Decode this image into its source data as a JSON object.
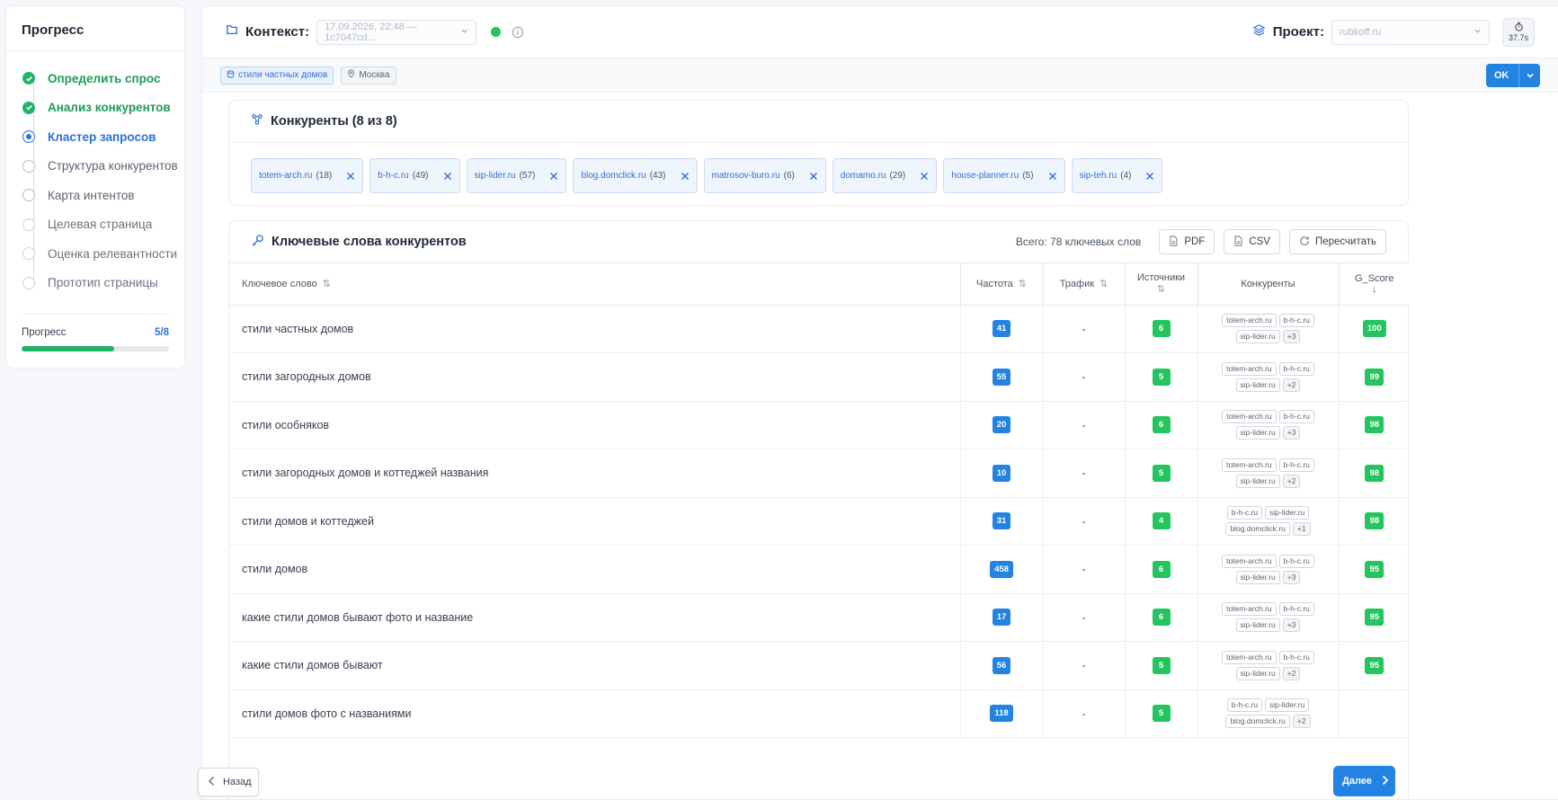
{
  "sidebar": {
    "title": "Прогресс",
    "steps": [
      {
        "label": "Определить спрос",
        "state": "done"
      },
      {
        "label": "Анализ конкурентов",
        "state": "done"
      },
      {
        "label": "Кластер запросов",
        "state": "active"
      },
      {
        "label": "Структура конкурентов",
        "state": "pending"
      },
      {
        "label": "Карта интентов",
        "state": "pending"
      },
      {
        "label": "Целевая страница",
        "state": "pending"
      },
      {
        "label": "Оценка релевантности",
        "state": "pending"
      },
      {
        "label": "Прототип страницы",
        "state": "pending"
      }
    ],
    "progress_label": "Прогресс",
    "progress_count": "5/8",
    "progress_value": 0.625
  },
  "topbar": {
    "context_label": "Контекст:",
    "context_value": "17.09.2026, 22:48 — 1c7047cd…",
    "project_label": "Проект:",
    "project_value": "rubkoff.ru",
    "timer": "37.7s"
  },
  "subbar": {
    "query_chip": "стили частных домов",
    "region_chip": "Москва",
    "ok_label": "OK"
  },
  "competitors": {
    "title": "Конкуренты (8 из 8)",
    "items": [
      {
        "domain": "totem-arch.ru",
        "count": "(18)"
      },
      {
        "domain": "b-h-c.ru",
        "count": "(49)"
      },
      {
        "domain": "sip-lider.ru",
        "count": "(57)"
      },
      {
        "domain": "blog.domclick.ru",
        "count": "(43)"
      },
      {
        "domain": "matrosov-buro.ru",
        "count": "(6)"
      },
      {
        "domain": "domamo.ru",
        "count": "(29)"
      },
      {
        "domain": "house-planner.ru",
        "count": "(5)"
      },
      {
        "domain": "sip-teh.ru",
        "count": "(4)"
      }
    ]
  },
  "keywords": {
    "title": "Ключевые слова конкурентов",
    "total": "Всего: 78 ключевых слов",
    "pdf_label": "PDF",
    "csv_label": "CSV",
    "recalc_label": "Пересчитать",
    "columns": {
      "keyword": "Ключевое слово",
      "freq": "Частота",
      "traffic": "Трафик",
      "sources": "Источники",
      "competitors": "Конкуренты",
      "score": "G_Score"
    },
    "rows": [
      {
        "keyword": "стили частных домов",
        "freq": "41",
        "traffic": "-",
        "sources": "6",
        "tags": [
          "totem-arch.ru",
          "b-h-c.ru",
          "sip-lider.ru"
        ],
        "more": "+3",
        "score": "100"
      },
      {
        "keyword": "стили загородных домов",
        "freq": "55",
        "traffic": "-",
        "sources": "5",
        "tags": [
          "totem-arch.ru",
          "b-h-c.ru",
          "sip-lider.ru"
        ],
        "more": "+2",
        "score": "99"
      },
      {
        "keyword": "стили особняков",
        "freq": "20",
        "traffic": "-",
        "sources": "6",
        "tags": [
          "totem-arch.ru",
          "b-h-c.ru",
          "sip-lider.ru"
        ],
        "more": "+3",
        "score": "98"
      },
      {
        "keyword": "стили загородных домов и коттеджей названия",
        "freq": "10",
        "traffic": "-",
        "sources": "5",
        "tags": [
          "totem-arch.ru",
          "b-h-c.ru",
          "sip-lider.ru"
        ],
        "more": "+2",
        "score": "98"
      },
      {
        "keyword": "стили домов и коттеджей",
        "freq": "31",
        "traffic": "-",
        "sources": "4",
        "tags": [
          "b-h-c.ru",
          "sip-lider.ru",
          "blog.domclick.ru"
        ],
        "more": "+1",
        "score": "98"
      },
      {
        "keyword": "стили домов",
        "freq": "458",
        "traffic": "-",
        "sources": "6",
        "tags": [
          "totem-arch.ru",
          "b-h-c.ru",
          "sip-lider.ru"
        ],
        "more": "+3",
        "score": "95"
      },
      {
        "keyword": "какие стили домов бывают фото и название",
        "freq": "17",
        "traffic": "-",
        "sources": "6",
        "tags": [
          "totem-arch.ru",
          "b-h-c.ru",
          "sip-lider.ru"
        ],
        "more": "+3",
        "score": "95"
      },
      {
        "keyword": "какие стили домов бывают",
        "freq": "56",
        "traffic": "-",
        "sources": "5",
        "tags": [
          "totem-arch.ru",
          "b-h-c.ru",
          "sip-lider.ru"
        ],
        "more": "+2",
        "score": "95"
      },
      {
        "keyword": "стили домов фото с названиями",
        "freq": "118",
        "traffic": "-",
        "sources": "5",
        "tags": [
          "b-h-c.ru",
          "sip-lider.ru",
          "blog.domclick.ru"
        ],
        "more": "+2",
        "score": ""
      }
    ]
  },
  "nav": {
    "back_label": "Назад",
    "next_label": "Далее"
  },
  "colors": {
    "accent": "#2383e2",
    "success": "#22c55e"
  }
}
